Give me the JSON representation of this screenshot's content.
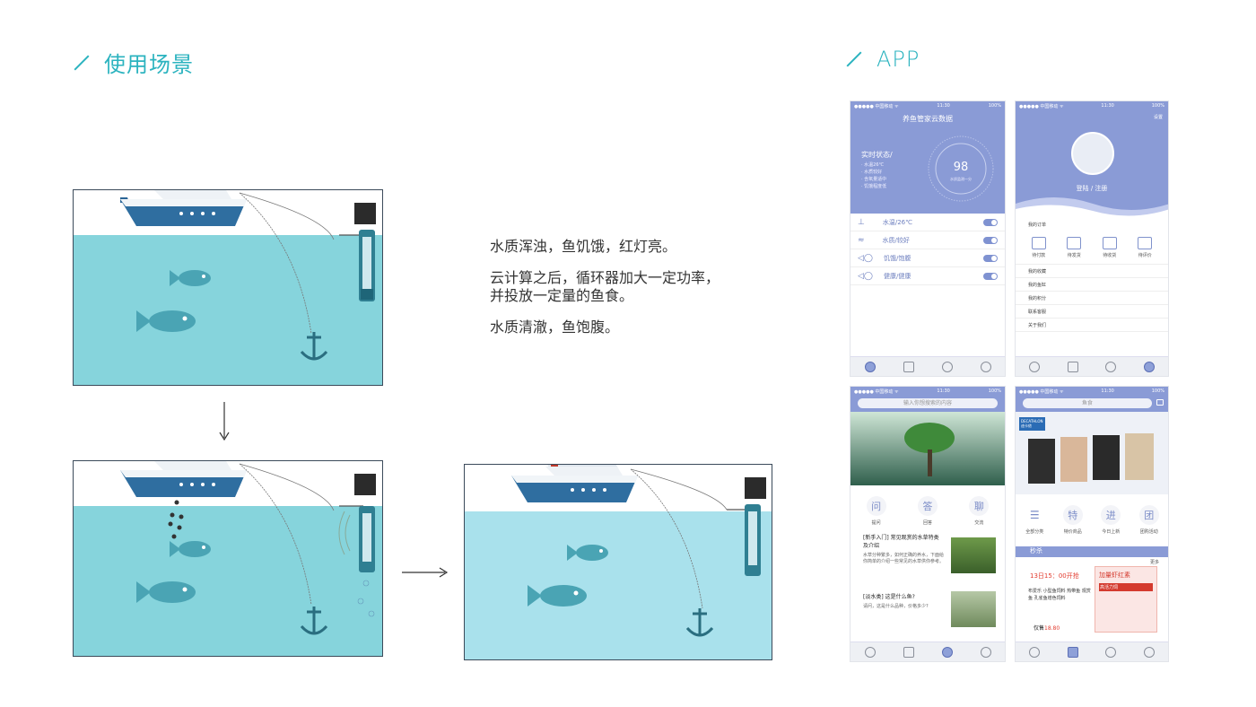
{
  "sections": {
    "scene_title": "使用场景",
    "app_title": "APP"
  },
  "description": {
    "line1": "水质浑浊，鱼饥饿，红灯亮。",
    "line2": "云计算之后，循环器加大一定功率，",
    "line3": "并投放一定量的鱼食。",
    "line4": "水质清澈，鱼饱腹。"
  },
  "phone1": {
    "status_left": "●●●●● 中国移动 ᯤ",
    "status_time": "11:30",
    "status_right": "100%",
    "title": "养鱼管家云数据",
    "status_heading": "实时状态/",
    "status_items": [
      "· 水温26℃",
      "· 水质较好",
      "· 含氧量适中",
      "· 饥饿程度低"
    ],
    "gauge_value": "98",
    "gauge_caption": "水质监测一分",
    "rows": [
      {
        "label": "水温/26℃",
        "icon": "thermometer-icon"
      },
      {
        "label": "水质/较好",
        "icon": "water-icon"
      },
      {
        "label": "饥饿/饱腹",
        "icon": "fish-icon"
      },
      {
        "label": "健康/健康",
        "icon": "fish-health-icon"
      }
    ]
  },
  "phone2": {
    "status_left": "●●●●● 中国移动 ᯤ",
    "status_time": "11:30",
    "status_right": "100%",
    "corner": "设置",
    "login": "登陆 / 注册",
    "menu_top": "我的订单",
    "grid": [
      "待付款",
      "待发货",
      "待收货",
      "待评价"
    ],
    "menu": [
      "我的收藏",
      "我的鱼缸",
      "我的积分",
      "联系客服",
      "关于我们"
    ]
  },
  "phone3": {
    "status_left": "●●●●● 中国移动 ᯤ",
    "status_time": "11:30",
    "status_right": "100%",
    "search": "输入你想搜索的内容",
    "quick": [
      {
        "glyph": "问",
        "label": "提问"
      },
      {
        "glyph": "答",
        "label": "回答"
      },
      {
        "glyph": "聊",
        "label": "交流"
      }
    ],
    "article1_title": "[新手入门] 常见观赏的水草特类及介绍",
    "article1_sub": "水草分种繁多，如何正确的养水，下面给你简单的介绍一些常见的水草供你参考。",
    "article2_title": "[淡水类] 这是什么鱼?",
    "article2_sub": "请问，这是什么品种，价格多少?"
  },
  "phone4": {
    "status_left": "●●●●● 中国移动 ᯤ",
    "status_time": "11:30",
    "status_right": "100%",
    "search": "鱼食",
    "brand": "DECATHLON",
    "brand_cn": "迪卡侬",
    "quick": [
      {
        "glyph": "特",
        "label": "特价商品"
      },
      {
        "glyph": "进",
        "label": "今日上新"
      },
      {
        "glyph": "团",
        "label": "团购活动"
      }
    ],
    "list_label": "全部分类",
    "flash_title": "秒杀",
    "flash_time": "13日15：00开抢",
    "flash_more": "更多",
    "product_desc": "布爱乐 小型鱼饲料 热带鱼 观赏鱼 孔雀鱼增色饲料",
    "price_label": "仅售",
    "price": "18.80",
    "product_title": "加量虾红素",
    "product_badge": "高活力饲"
  },
  "colors": {
    "accent": "#2bb3bf",
    "water": "#86d4dc",
    "water_clear": "#a9e1ec",
    "app_blue": "#8a9bd6"
  }
}
